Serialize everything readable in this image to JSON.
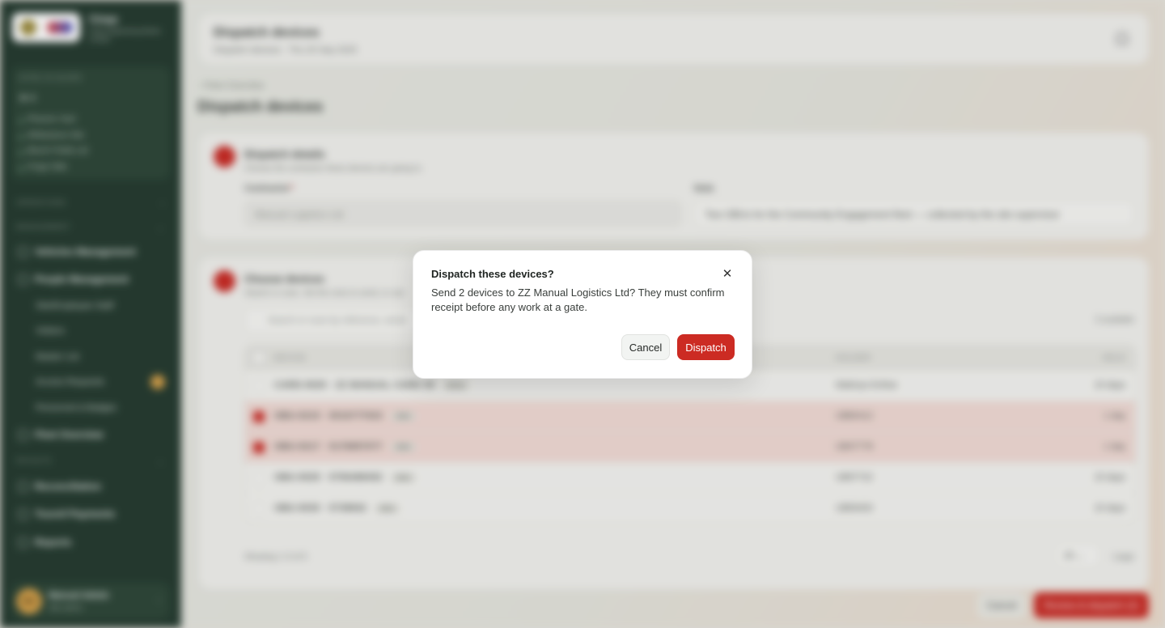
{
  "sidebar": {
    "org_name": "Cinqs",
    "org_subtitle": "Civils Engineering Works Limited",
    "site_header": "SITES IN SCOPE",
    "site_count": "4",
    "sites": [
      "Phoenix Yard",
      "Whitestone Site",
      "Beech Fields Ltd",
      "Forge Side"
    ],
    "sections": {
      "operations": "OPERATIONS",
      "management": "MANAGEMENT",
      "payroll": "PAYOUTS"
    },
    "items": {
      "vehicles": "Vehicles Management",
      "people": "People Management",
      "fleet": "Fleet Overview",
      "reconciliation": "Reconciliation",
      "payments": "Toureil Payments",
      "reports": "Reports"
    },
    "people_sub": [
      "Site/Employee Staff",
      "Visitors",
      "Master List",
      "Access Requests",
      "Personnel & Badges"
    ],
    "user": {
      "initials": "MA",
      "name": "Manual Admin",
      "role": "Site admin"
    }
  },
  "header": {
    "title": "Dispatch devices",
    "subtitle": "Dispatch devices · Thu 25 Sep 2025"
  },
  "breadcrumb": "Fleet Overview",
  "page_title": "Dispatch devices",
  "details_card": {
    "title": "Dispatch details",
    "subtitle": "Choose the contractor these devices are going to.",
    "contractor_label": "Contractor",
    "required_mark": "*",
    "contractor_value": "Manual Logistics Ltd",
    "note_label": "Note",
    "note_value": "Two OBUs for the Community Engagement fleet — collected by the site supervisor"
  },
  "devices_card": {
    "title": "Choose devices",
    "subtitle": "Search or scan. Set the ones to send, or use",
    "search_placeholder": "Search or scan by reference, serial",
    "available": "5 available",
    "columns": {
      "device": "DEVICE",
      "holder": "HOLDER",
      "held": "HELD"
    },
    "rows": [
      {
        "device": "CARD-0029 · ZZ MANUAL CARD 08",
        "tag": "RFID",
        "holder": "Makinyo Enthar",
        "held": "15 days",
        "selected": false
      },
      {
        "device": "OBU-0215 · 0016777023",
        "tag": "OBU",
        "holder": "UB80412",
        "held": "1 day",
        "selected": true
      },
      {
        "device": "OBU-0217 · 0176857077",
        "tag": "OBU",
        "holder": "UB47778",
        "held": "1 day",
        "selected": true
      },
      {
        "device": "OBU-0029 · 0756488452",
        "tag": "OBU",
        "holder": "UB97722",
        "held": "15 days",
        "selected": false
      },
      {
        "device": "OBU-0030 · 0738842",
        "tag": "OBU",
        "holder": "UB69400",
        "held": "15 days",
        "selected": false
      }
    ],
    "showing": "Showing 1–5 of 5",
    "page_size": "25",
    "page_label": "/ page"
  },
  "footer": {
    "cancel": "Cancel",
    "primary": "Review & dispatch (2)"
  },
  "modal": {
    "title": "Dispatch these devices?",
    "body": "Send 2 devices to ZZ Manual Logistics Ltd? They must confirm receipt before any work at a gate.",
    "close_glyph": "✕",
    "cancel": "Cancel",
    "confirm": "Dispatch"
  },
  "colors": {
    "sidebar": "#243a2f",
    "accent": "#cc2b23",
    "modal_bg": "#ffffff"
  }
}
